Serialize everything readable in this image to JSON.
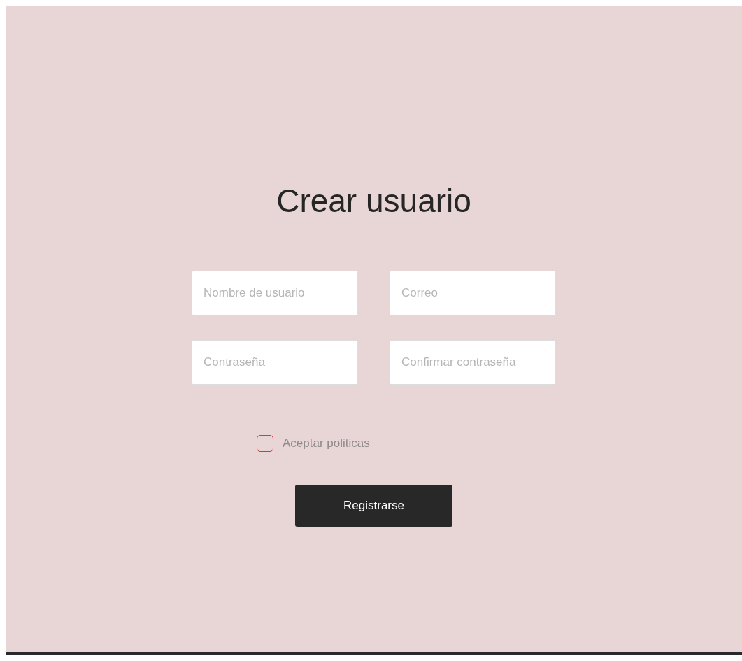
{
  "title": "Crear usuario",
  "fields": [
    {
      "placeholder": "Nombre de usuario"
    },
    {
      "placeholder": "Correo"
    },
    {
      "placeholder": "Contraseña"
    },
    {
      "placeholder": "Confirmar contraseña"
    }
  ],
  "policy": {
    "label": "Aceptar politicas",
    "checked": false
  },
  "submit": {
    "label": "Registrarse"
  }
}
